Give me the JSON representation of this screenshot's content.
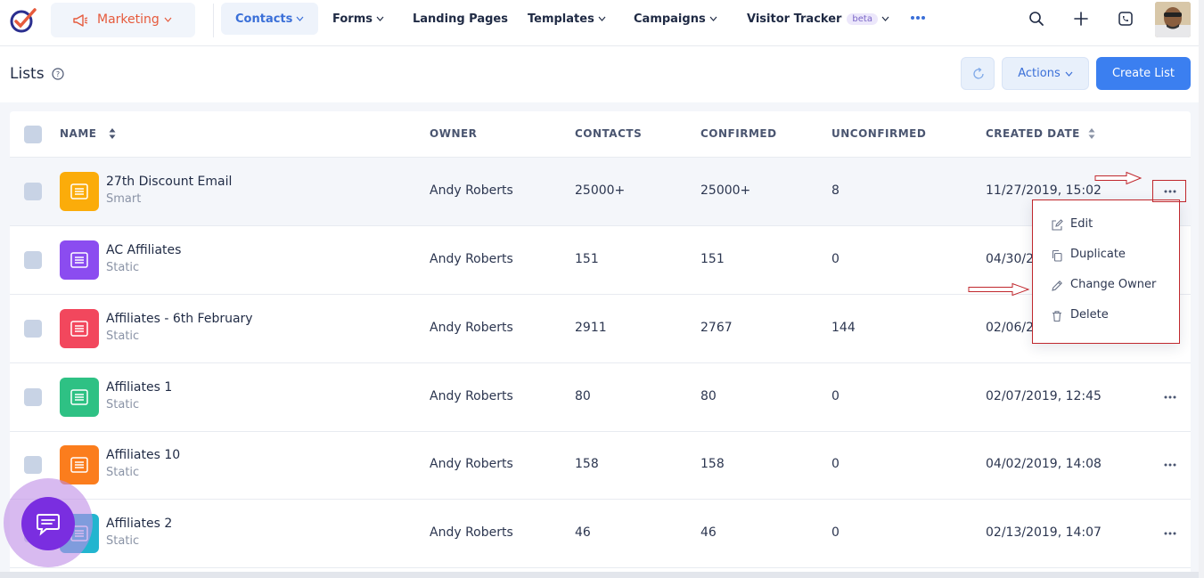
{
  "app": {
    "workspace": "Marketing",
    "colors": {
      "accent": "#3b7ff0",
      "brand": "#e65a3c",
      "chat": "#7a2ee0"
    }
  },
  "nav": {
    "items": [
      {
        "label": "Contacts",
        "active": true,
        "has_dropdown": true
      },
      {
        "label": "Forms",
        "has_dropdown": true
      },
      {
        "label": "Landing Pages",
        "has_dropdown": false
      },
      {
        "label": "Templates",
        "has_dropdown": true
      },
      {
        "label": "Campaigns",
        "has_dropdown": true
      },
      {
        "label": "Visitor Tracker",
        "has_dropdown": true,
        "badge": "beta"
      }
    ],
    "icons": [
      "more-icon",
      "search-icon",
      "plus-icon",
      "phone-icon",
      "avatar"
    ]
  },
  "header": {
    "title": "Lists",
    "actions_label": "Actions",
    "create_label": "Create List"
  },
  "table": {
    "columns": [
      "NAME",
      "OWNER",
      "CONTACTS",
      "CONFIRMED",
      "UNCONFIRMED",
      "CREATED DATE"
    ],
    "rows": [
      {
        "name": "27th Discount Email",
        "type": "Smart",
        "owner": "Andy Roberts",
        "contacts": "25000+",
        "confirmed": "25000+",
        "unconfirmed": "8",
        "created": "11/27/2019, 15:02",
        "icon_color": "#fbac0a"
      },
      {
        "name": "AC Affiliates",
        "type": "Static",
        "owner": "Andy Roberts",
        "contacts": "151",
        "confirmed": "151",
        "unconfirmed": "0",
        "created": "04/30/2",
        "icon_color": "#8b4cf0"
      },
      {
        "name": "Affiliates - 6th February",
        "type": "Static",
        "owner": "Andy Roberts",
        "contacts": "2911",
        "confirmed": "2767",
        "unconfirmed": "144",
        "created": "02/06/2",
        "icon_color": "#f2475d"
      },
      {
        "name": "Affiliates 1",
        "type": "Static",
        "owner": "Andy Roberts",
        "contacts": "80",
        "confirmed": "80",
        "unconfirmed": "0",
        "created": "02/07/2019, 12:45",
        "icon_color": "#2ec184"
      },
      {
        "name": "Affiliates 10",
        "type": "Static",
        "owner": "Andy Roberts",
        "contacts": "158",
        "confirmed": "158",
        "unconfirmed": "0",
        "created": "04/02/2019, 14:08",
        "icon_color": "#fb7d1d"
      },
      {
        "name": "Affiliates 2",
        "type": "Static",
        "owner": "Andy Roberts",
        "contacts": "46",
        "confirmed": "46",
        "unconfirmed": "0",
        "created": "02/13/2019, 14:07",
        "icon_color": "#22b5cf"
      }
    ]
  },
  "menu": {
    "items": [
      {
        "label": "Edit",
        "icon": "edit-icon"
      },
      {
        "label": "Duplicate",
        "icon": "copy-icon"
      },
      {
        "label": "Change Owner",
        "icon": "pencil-icon"
      },
      {
        "label": "Delete",
        "icon": "trash-icon"
      }
    ]
  }
}
